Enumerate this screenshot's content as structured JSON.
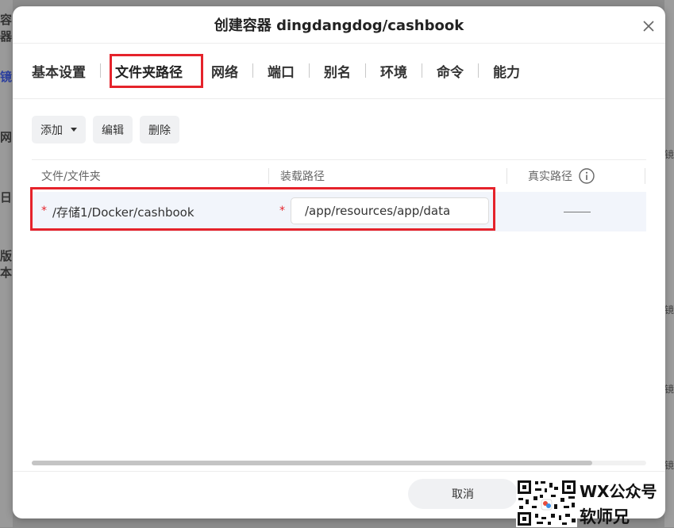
{
  "background": {
    "left_fragments": [
      "容器",
      "镜",
      "网",
      "日",
      "版本"
    ],
    "right_fragments": [
      "镜",
      "镜",
      "镜",
      "镜"
    ]
  },
  "dialog": {
    "title": "创建容器 dingdangdog/cashbook",
    "close_icon": "close-icon"
  },
  "tabs": [
    {
      "label": "基本设置"
    },
    {
      "label": "文件夹路径"
    },
    {
      "label": "网络"
    },
    {
      "label": "端口"
    },
    {
      "label": "别名"
    },
    {
      "label": "环境"
    },
    {
      "label": "命令"
    },
    {
      "label": "能力"
    }
  ],
  "active_tab": "文件夹路径",
  "toolbar": {
    "add_label": "添加",
    "edit_label": "编辑",
    "delete_label": "删除"
  },
  "table": {
    "columns": [
      "文件/文件夹",
      "装载路径",
      "真实路径"
    ],
    "rows": [
      {
        "required_mark": "*",
        "folder": "/存储1/Docker/cashbook",
        "mount_path": "/app/resources/app/data",
        "real_path": "——"
      }
    ]
  },
  "footer": {
    "cancel_label": "取消"
  },
  "watermark": {
    "line1": "WX公众号",
    "line2": "软师兄"
  },
  "colors": {
    "accent": "#3a6cf0",
    "highlight": "#e5232b",
    "row_bg": "#f2f5fb"
  }
}
